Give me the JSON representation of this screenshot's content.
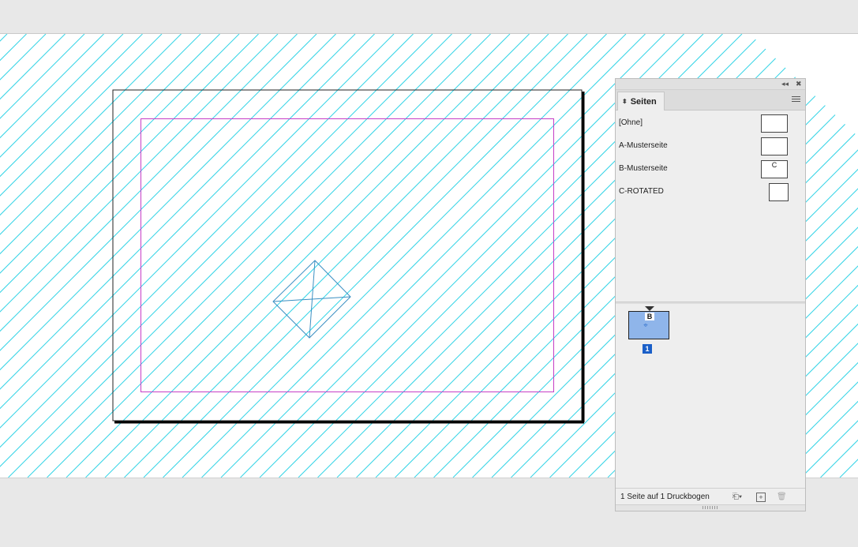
{
  "panel": {
    "tab_label": "Seiten",
    "collapse_icon": "double-chevron-left-icon",
    "close_icon": "close-icon",
    "menu_icon": "panel-menu-icon",
    "masters": [
      {
        "label": "[Ohne]",
        "thumb_letter": ""
      },
      {
        "label": "A-Musterseite",
        "thumb_letter": ""
      },
      {
        "label": "B-Musterseite",
        "thumb_letter": "C"
      },
      {
        "label": "C-ROTATED",
        "thumb_letter": ""
      }
    ],
    "page": {
      "master_badge": "B",
      "number": "1"
    },
    "footer": {
      "status": "1 Seite auf 1 Druckbogen",
      "edit_page_size_icon": "page-size-icon",
      "new_page_icon": "new-page-icon",
      "delete_page_icon": "trash-icon"
    }
  },
  "colors": {
    "pasteboard_hatch": "#35d4e6",
    "margin_guide": "#c63ec6",
    "frame_lines": "#3a8fc2",
    "page_thumb_fill": "#8fb5ea",
    "page_number_badge": "#1a5fc8"
  }
}
